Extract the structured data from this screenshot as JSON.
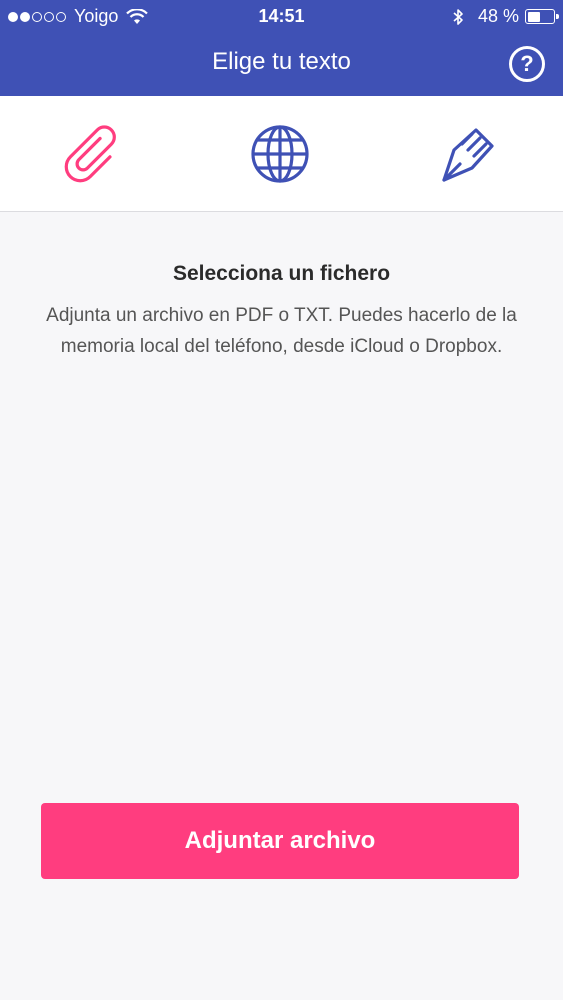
{
  "status_bar": {
    "carrier": "Yoigo",
    "time": "14:51",
    "battery": "48 %",
    "battery_level": 0.48,
    "signal_bars_filled": 2,
    "signal_bars_total": 5
  },
  "header": {
    "title": "Elige tu texto",
    "help_label": "?"
  },
  "tabs": [
    {
      "icon": "paperclip-icon",
      "color": "#ff3d7f",
      "selected": true
    },
    {
      "icon": "globe-icon",
      "color": "#3f51b5",
      "selected": false
    },
    {
      "icon": "pen-nib-icon",
      "color": "#3f51b5",
      "selected": false
    }
  ],
  "content": {
    "heading": "Selecciona un fichero",
    "description": "Adjunta un archivo en PDF o TXT. Puedes hacerlo de la memoria local del teléfono, desde iCloud o Dropbox."
  },
  "actions": {
    "attach_label": "Adjuntar archivo"
  },
  "colors": {
    "header_bg": "#3f51b5",
    "accent": "#ff3d7f",
    "page_bg": "#f7f7f9"
  }
}
